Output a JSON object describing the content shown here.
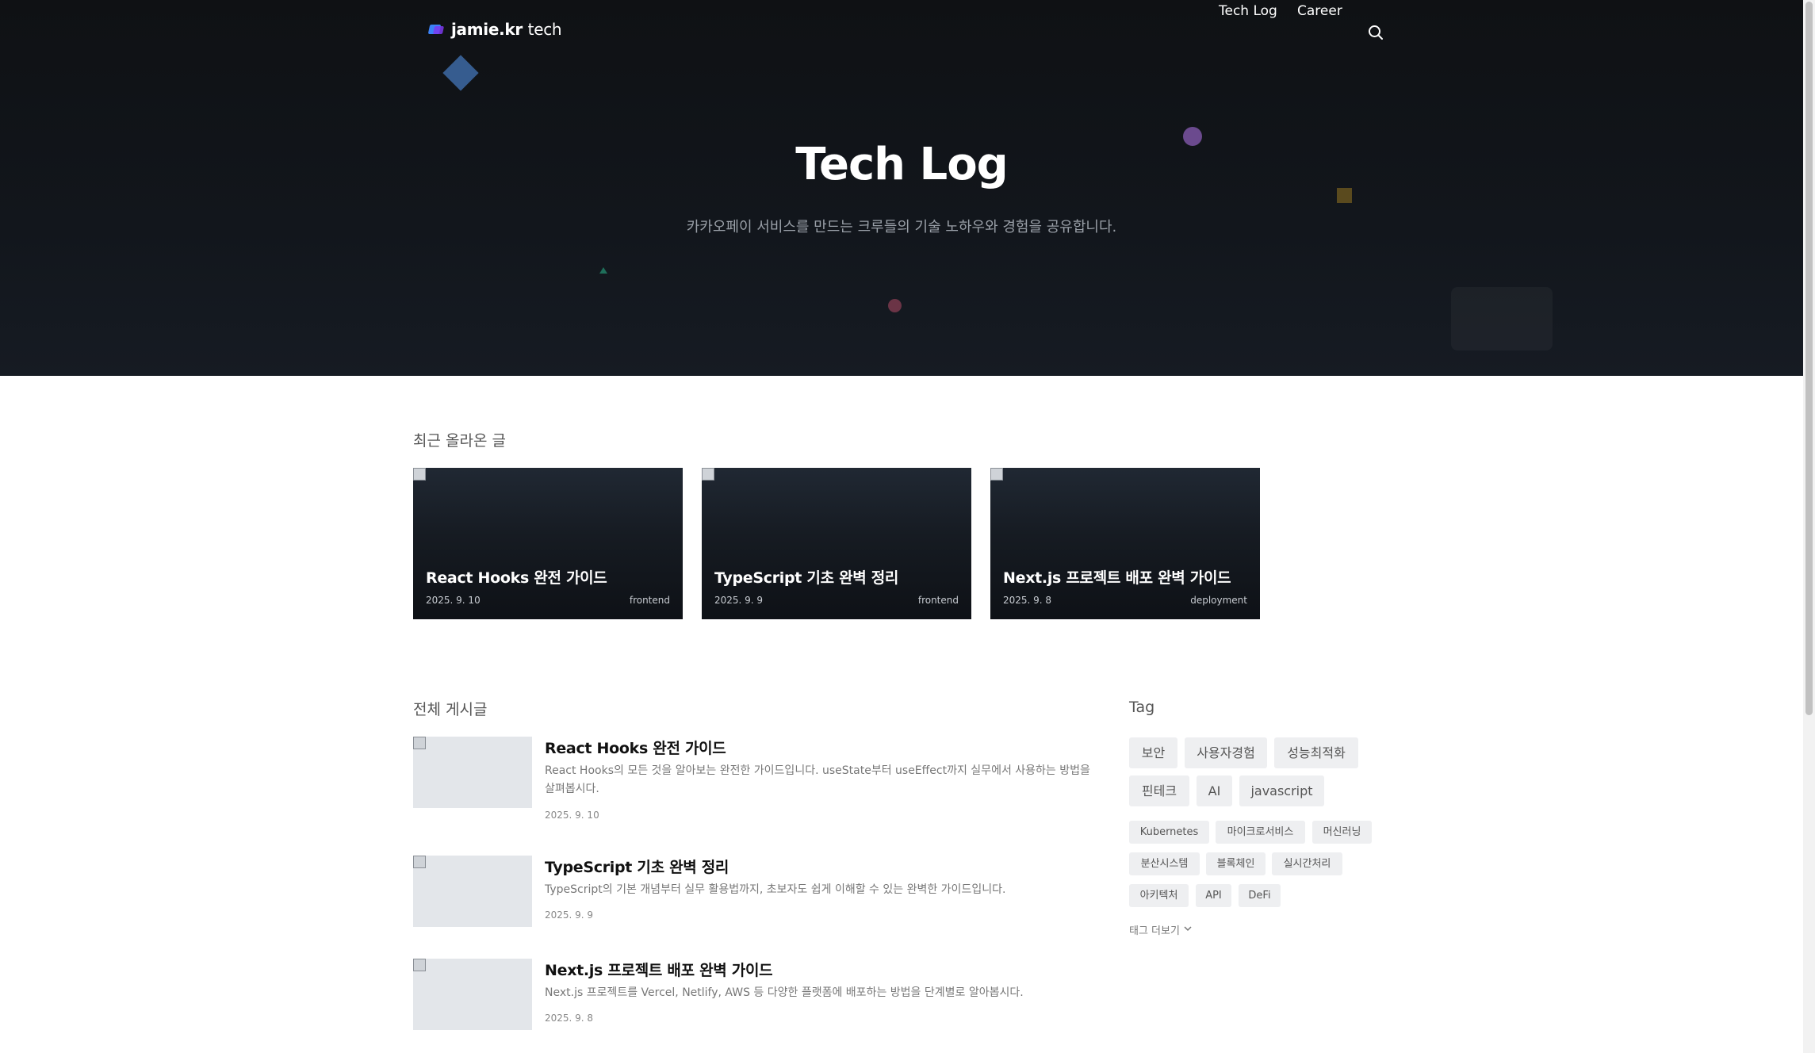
{
  "header": {
    "logo_bold": "jamie.kr",
    "logo_light": "tech",
    "nav": [
      "Tech Log",
      "Career"
    ]
  },
  "hero": {
    "title": "Tech Log",
    "subtitle": "카카오페이 서비스를 만드는 크루들의 기술 노하우와 경험을 공유합니다."
  },
  "recent": {
    "heading": "최근 올라온 글",
    "cards": [
      {
        "title": "React Hooks 완전 가이드",
        "date": "2025. 9. 10",
        "tag": "frontend"
      },
      {
        "title": "TypeScript 기초 완벽 정리",
        "date": "2025. 9. 9",
        "tag": "frontend"
      },
      {
        "title": "Next.js 프로젝트 배포 완벽 가이드",
        "date": "2025. 9. 8",
        "tag": "deployment"
      }
    ]
  },
  "all_posts": {
    "heading": "전체 게시글",
    "posts": [
      {
        "title": "React Hooks 완전 가이드",
        "desc": "React Hooks의 모든 것을 알아보는 완전한 가이드입니다. useState부터 useEffect까지 실무에서 사용하는 방법을 살펴봅시다.",
        "date": "2025. 9. 10"
      },
      {
        "title": "TypeScript 기초 완벽 정리",
        "desc": "TypeScript의 기본 개념부터 실무 활용법까지, 초보자도 쉽게 이해할 수 있는 완벽한 가이드입니다.",
        "date": "2025. 9. 9"
      },
      {
        "title": "Next.js 프로젝트 배포 완벽 가이드",
        "desc": "Next.js 프로젝트를 Vercel, Netlify, AWS 등 다양한 플랫폼에 배포하는 방법을 단계별로 알아봅시다.",
        "date": "2025. 9. 8"
      }
    ]
  },
  "tags": {
    "heading": "Tag",
    "primary": [
      "보안",
      "사용자경험",
      "성능최적화",
      "핀테크",
      "AI",
      "javascript"
    ],
    "secondary": [
      "Kubernetes",
      "마이크로서비스",
      "머신러닝",
      "분산시스템",
      "블록체인",
      "실시간처리",
      "아키텍처",
      "API",
      "DeFi"
    ],
    "more_label": "태그 더보기"
  },
  "icons": {
    "search": "search-icon",
    "chevron": "chevron-down-icon",
    "broken_image": "broken-image-icon"
  }
}
